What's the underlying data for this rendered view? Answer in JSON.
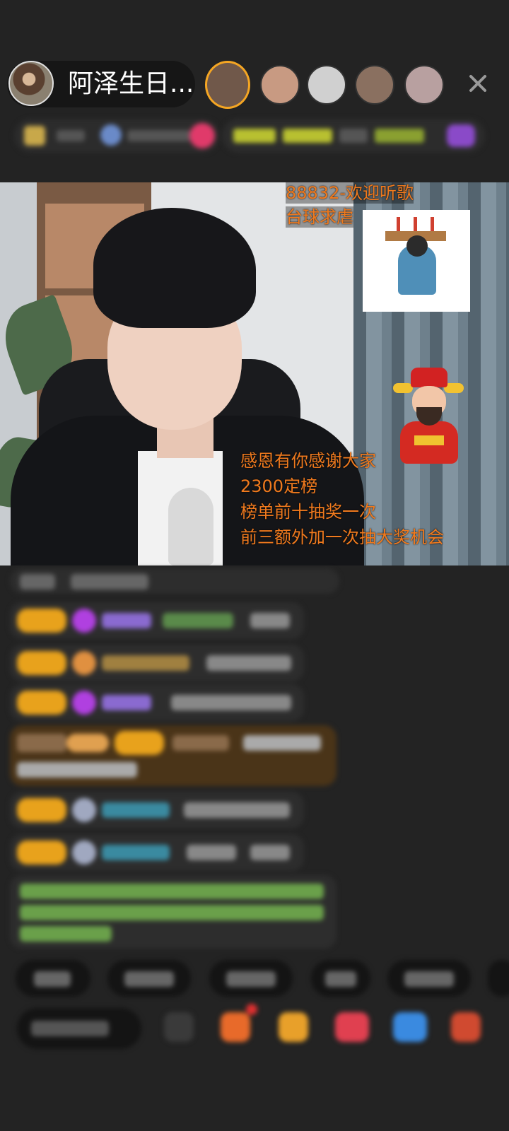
{
  "header": {
    "host_name": "阿泽生日...",
    "close_icon": "close-icon",
    "colors": {
      "accent": "#f5a623",
      "badge": "#e8a21c"
    }
  },
  "stream": {
    "overlay_lines": [
      "88832-欢迎听歌",
      "台球求虐",
      "感恩有你感谢大家",
      "2300定榜",
      "榜单前十抽奖一次",
      "前三额外加一次抽大奖机会"
    ],
    "overlay_color": "#f07a1e"
  },
  "chat": {
    "messages_blurred": 9
  },
  "toolbar": {
    "quick_replies_blurred": 6,
    "tool_icons": [
      "gift-icon",
      "package-icon",
      "chat-icon",
      "game-icon",
      "more-icon"
    ]
  }
}
